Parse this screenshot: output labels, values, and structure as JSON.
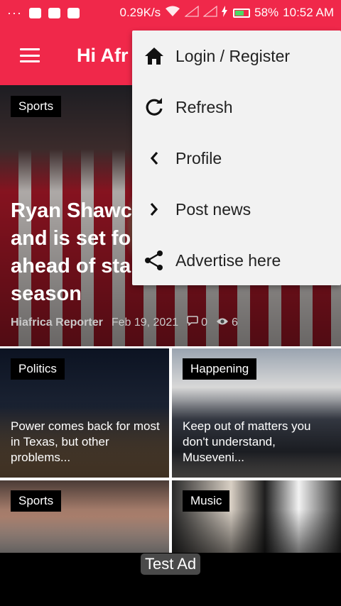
{
  "status_bar": {
    "left_dots": "···",
    "speed": "0.29K/s",
    "battery": "58%",
    "time": "10:52 AM"
  },
  "app_bar": {
    "title": "Hi Afr"
  },
  "hero": {
    "category": "Sports",
    "title": "Ryan Shawcr and is set for ahead of sta season",
    "title_lines": [
      "Ryan Shawcr",
      "and is set for",
      "ahead of sta",
      "season"
    ],
    "author": "Hiafrica Reporter",
    "date": "Feb 19, 2021",
    "comments": "0",
    "views": "6"
  },
  "grid": [
    {
      "category": "Politics",
      "title": "Power comes back for most in Texas, but other problems..."
    },
    {
      "category": "Happening",
      "title": "Keep out of matters you don't understand, Museveni..."
    },
    {
      "category": "Sports",
      "title": ""
    },
    {
      "category": "Music",
      "title": ""
    }
  ],
  "ad": {
    "label": "Test Ad"
  },
  "menu": {
    "items": [
      {
        "label": "Login / Register",
        "icon": "home-icon"
      },
      {
        "label": "Refresh",
        "icon": "refresh-icon"
      },
      {
        "label": "Profile",
        "icon": "chevron-left-icon"
      },
      {
        "label": "Post news",
        "icon": "chevron-right-icon"
      },
      {
        "label": "Advertise here",
        "icon": "share-icon"
      }
    ]
  },
  "colors": {
    "brand": "#f0284a",
    "menu_bg": "#f2f2f2"
  }
}
